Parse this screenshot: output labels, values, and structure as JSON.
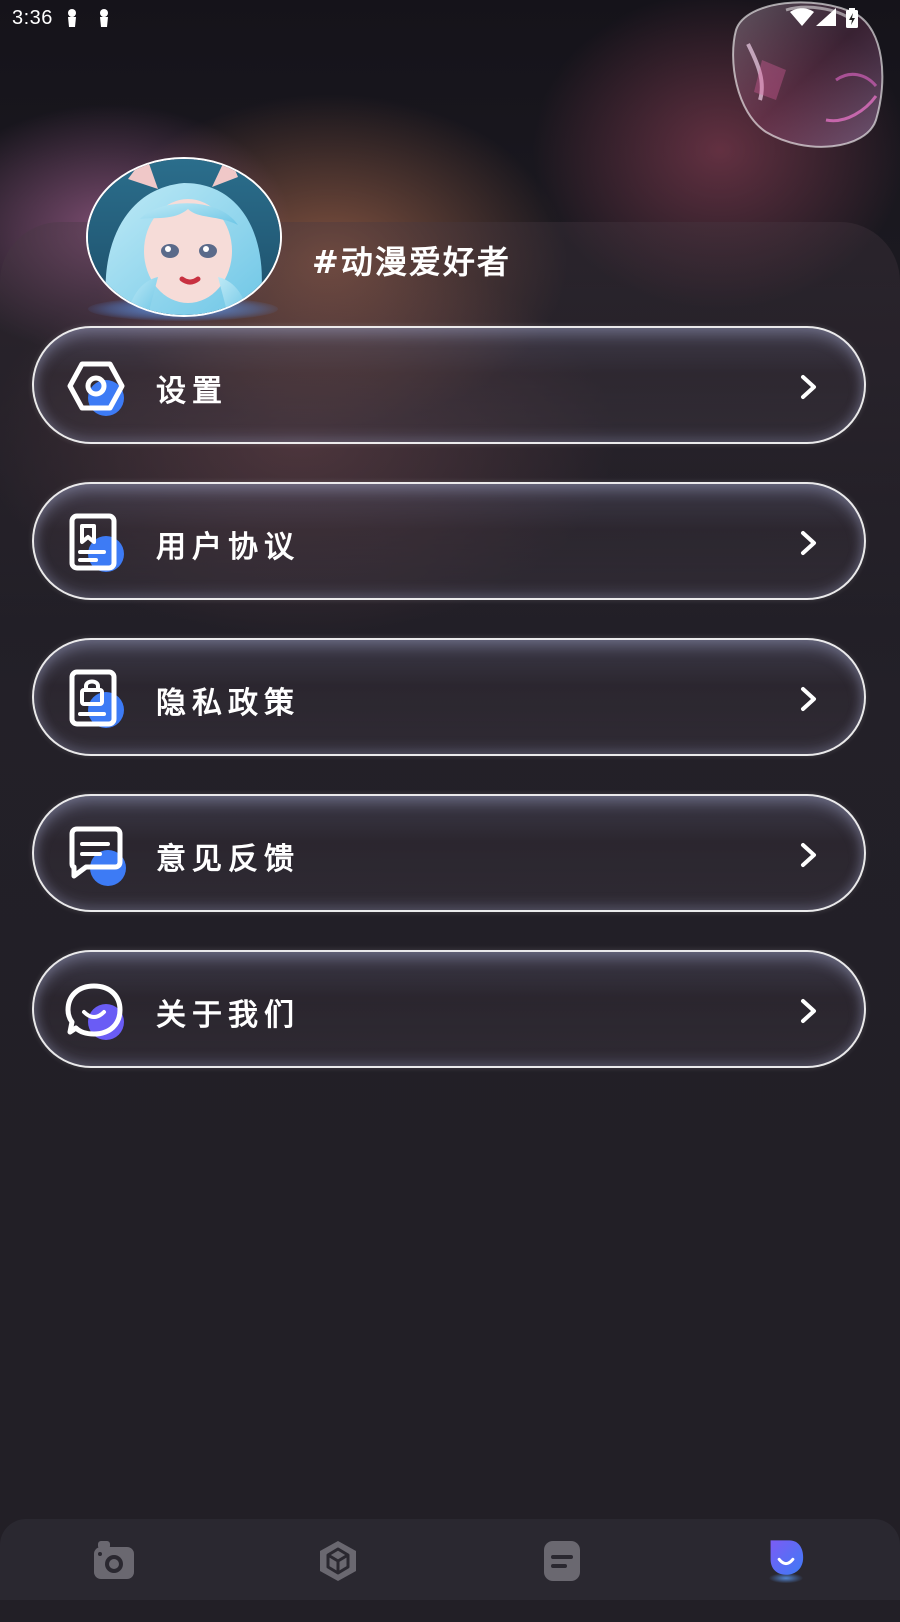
{
  "status_bar": {
    "time": "3:36"
  },
  "profile": {
    "username": "#动漫爱好者"
  },
  "menu": {
    "items": [
      {
        "label": "设置",
        "icon": "settings-icon"
      },
      {
        "label": "用户协议",
        "icon": "user-agreement-icon"
      },
      {
        "label": "隐私政策",
        "icon": "privacy-policy-icon"
      },
      {
        "label": "意见反馈",
        "icon": "feedback-icon"
      },
      {
        "label": "关于我们",
        "icon": "about-us-icon"
      }
    ]
  },
  "tab_bar": {
    "tabs": [
      {
        "icon": "camera-icon",
        "active": false
      },
      {
        "icon": "cube-icon",
        "active": false
      },
      {
        "icon": "document-icon",
        "active": false
      },
      {
        "icon": "profile-icon",
        "active": true
      }
    ]
  },
  "colors": {
    "background": "#221f26",
    "accent_blue": "#3d7bf5",
    "accent_purple": "#7b5cf5",
    "tab_inactive": "#6a6870",
    "tab_bar": "#2a2830"
  }
}
